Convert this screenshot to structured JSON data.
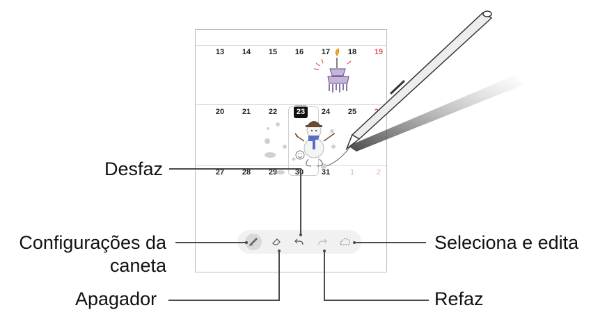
{
  "calendar": {
    "week1": [
      "13",
      "14",
      "15",
      "16",
      "17",
      "18",
      "19"
    ],
    "week2": [
      "20",
      "21",
      "22",
      "23",
      "24",
      "25",
      "26"
    ],
    "week3": [
      "27",
      "28",
      "29",
      "30",
      "31",
      "1",
      "2"
    ]
  },
  "toolbar": {
    "pen_settings_icon": "pen-icon",
    "eraser_icon": "eraser-icon",
    "undo_icon": "undo-icon",
    "redo_icon": "redo-icon",
    "lasso_icon": "lasso-icon"
  },
  "callouts": {
    "undo": "Desfaz",
    "pen_settings_line1": "Configurações da",
    "pen_settings_line2": "caneta",
    "eraser": "Apagador",
    "select_edit": "Seleciona e edita",
    "redo": "Refaz"
  },
  "colors": {
    "sunday": "#e05555",
    "line": "#4a4a4a",
    "toolbar_bg": "#f1f1f1"
  }
}
